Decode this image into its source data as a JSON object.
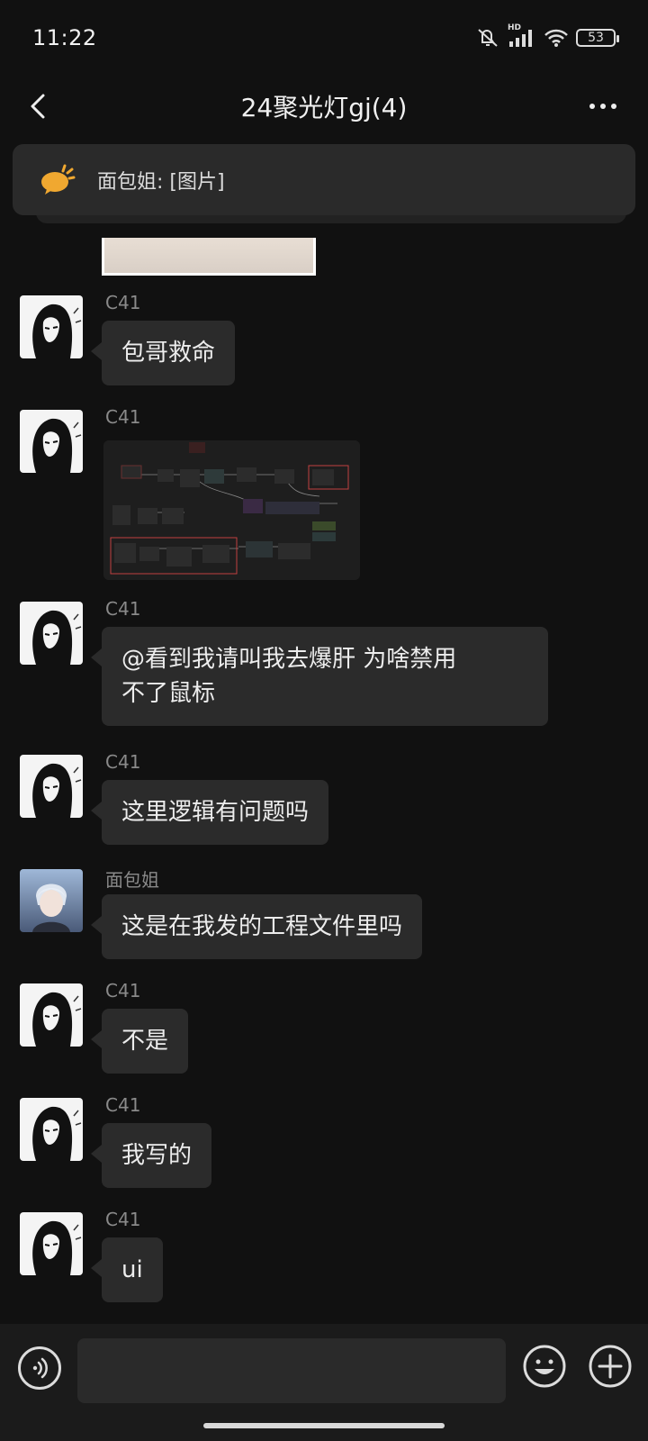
{
  "status": {
    "time": "11:22",
    "hd": "HD",
    "battery": "53"
  },
  "header": {
    "title": "24聚光灯gj(4)"
  },
  "pinned": {
    "text": "面包姐: [图片]"
  },
  "messages": [
    {
      "sender": "C41",
      "avatar": "anime-avatar",
      "type": "text",
      "lines": [
        "包哥救命"
      ]
    },
    {
      "sender": "C41",
      "avatar": "anime-avatar",
      "type": "image"
    },
    {
      "sender": "C41",
      "avatar": "anime-avatar",
      "type": "text",
      "lines": [
        "@看到我请叫我去爆肝  为啥禁用",
        "不了鼠标"
      ]
    },
    {
      "sender": "C41",
      "avatar": "anime-avatar",
      "type": "text",
      "lines": [
        "这里逻辑有问题吗"
      ]
    },
    {
      "sender": "面包姐",
      "avatar": "boy-avatar",
      "type": "text",
      "lines": [
        "这是在我发的工程文件里吗"
      ]
    },
    {
      "sender": "C41",
      "avatar": "anime-avatar",
      "type": "text",
      "lines": [
        "不是"
      ]
    },
    {
      "sender": "C41",
      "avatar": "anime-avatar",
      "type": "text",
      "lines": [
        "我写的"
      ]
    },
    {
      "sender": "C41",
      "avatar": "anime-avatar",
      "type": "text",
      "lines": [
        "ui"
      ]
    }
  ],
  "input": {
    "value": "",
    "placeholder": ""
  },
  "colors": {
    "background": "#111111",
    "bubble": "#2b2b2b",
    "sender": "#8a8a8a",
    "pin_icon": "#f0a830"
  }
}
